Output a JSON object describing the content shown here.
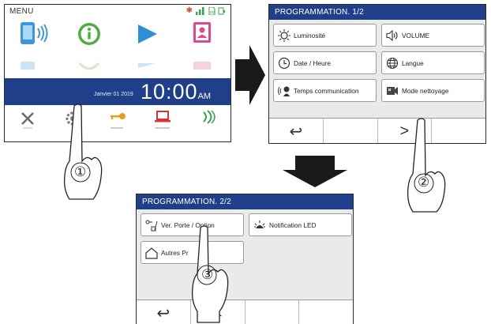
{
  "screen1": {
    "menu_label": "MENU",
    "date": "Janvier 01 2019",
    "time": "10:00",
    "ampm": "AM",
    "top_icons": [
      "phone-ring-icon",
      "info-icon",
      "play-icon",
      "contact-card-icon"
    ],
    "bottom_icons": [
      "close-icon",
      "gear-icon",
      "key-icon",
      "laptop-icon",
      "signal-icon"
    ],
    "colors": {
      "header_bar": "#1f3f8a",
      "status_green": "#2fa84a",
      "status_red": "#e0453d"
    }
  },
  "screen2": {
    "title": "PROGRAMMATION. 1/2",
    "tiles": [
      {
        "label": "Luminosité",
        "icon": "sun-icon"
      },
      {
        "label": "VOLUME",
        "icon": "speaker-icon"
      },
      {
        "label": "Date / Heure",
        "icon": "clock-icon"
      },
      {
        "label": "Langue",
        "icon": "globe-icon"
      },
      {
        "label": "Temps communication",
        "icon": "talk-icon"
      },
      {
        "label": "Mode nettoyage",
        "icon": "cleaning-icon"
      }
    ],
    "nav": {
      "back": "↩",
      "next": ">"
    }
  },
  "screen3": {
    "title": "PROGRAMMATION. 2/2",
    "tiles": [
      {
        "label": "Ver. Porte / Option",
        "icon": "door-lock-icon"
      },
      {
        "label": "Notification LED",
        "icon": "led-icon"
      },
      {
        "label": "Autres Pr",
        "icon": "house-icon"
      }
    ],
    "nav": {
      "back": "↩",
      "prev": "<"
    }
  },
  "steps": [
    "①",
    "②",
    "③"
  ]
}
